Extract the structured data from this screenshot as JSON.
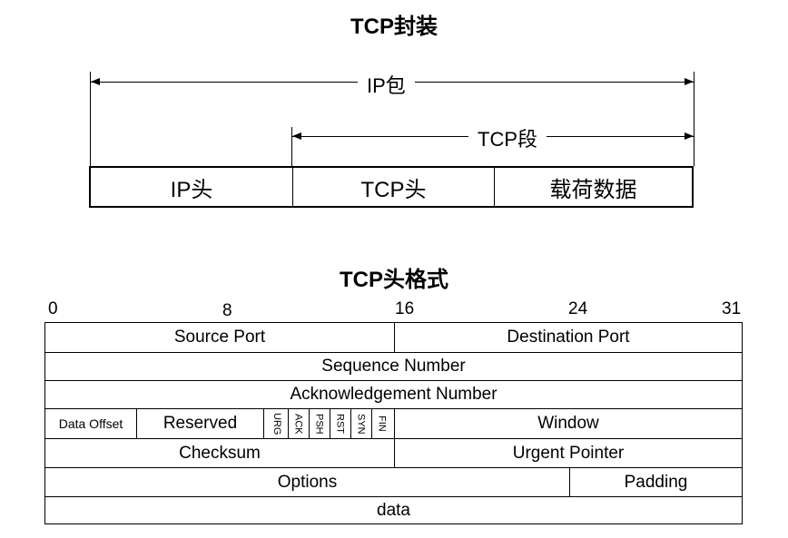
{
  "encapsulation": {
    "title": "TCP封装",
    "ip_packet_label": "IP包",
    "tcp_segment_label": "TCP段",
    "cells": [
      "IP头",
      "TCP头",
      "载荷数据"
    ]
  },
  "header_format": {
    "title": "TCP头格式",
    "bit_labels": [
      "0",
      "8",
      "16",
      "24",
      "31"
    ],
    "rows": {
      "r1": [
        "Source Port",
        "Destination Port"
      ],
      "r2": [
        "Sequence Number"
      ],
      "r3": [
        "Acknowledgement Number"
      ],
      "r4": {
        "data_offset": "Data Offset",
        "reserved": "Reserved",
        "flags": [
          "URG",
          "ACK",
          "PSH",
          "RST",
          "SYN",
          "FIN"
        ],
        "window": "Window"
      },
      "r5": [
        "Checksum",
        "Urgent Pointer"
      ],
      "r6": [
        "Options",
        "Padding"
      ],
      "r7": [
        "data"
      ]
    }
  }
}
